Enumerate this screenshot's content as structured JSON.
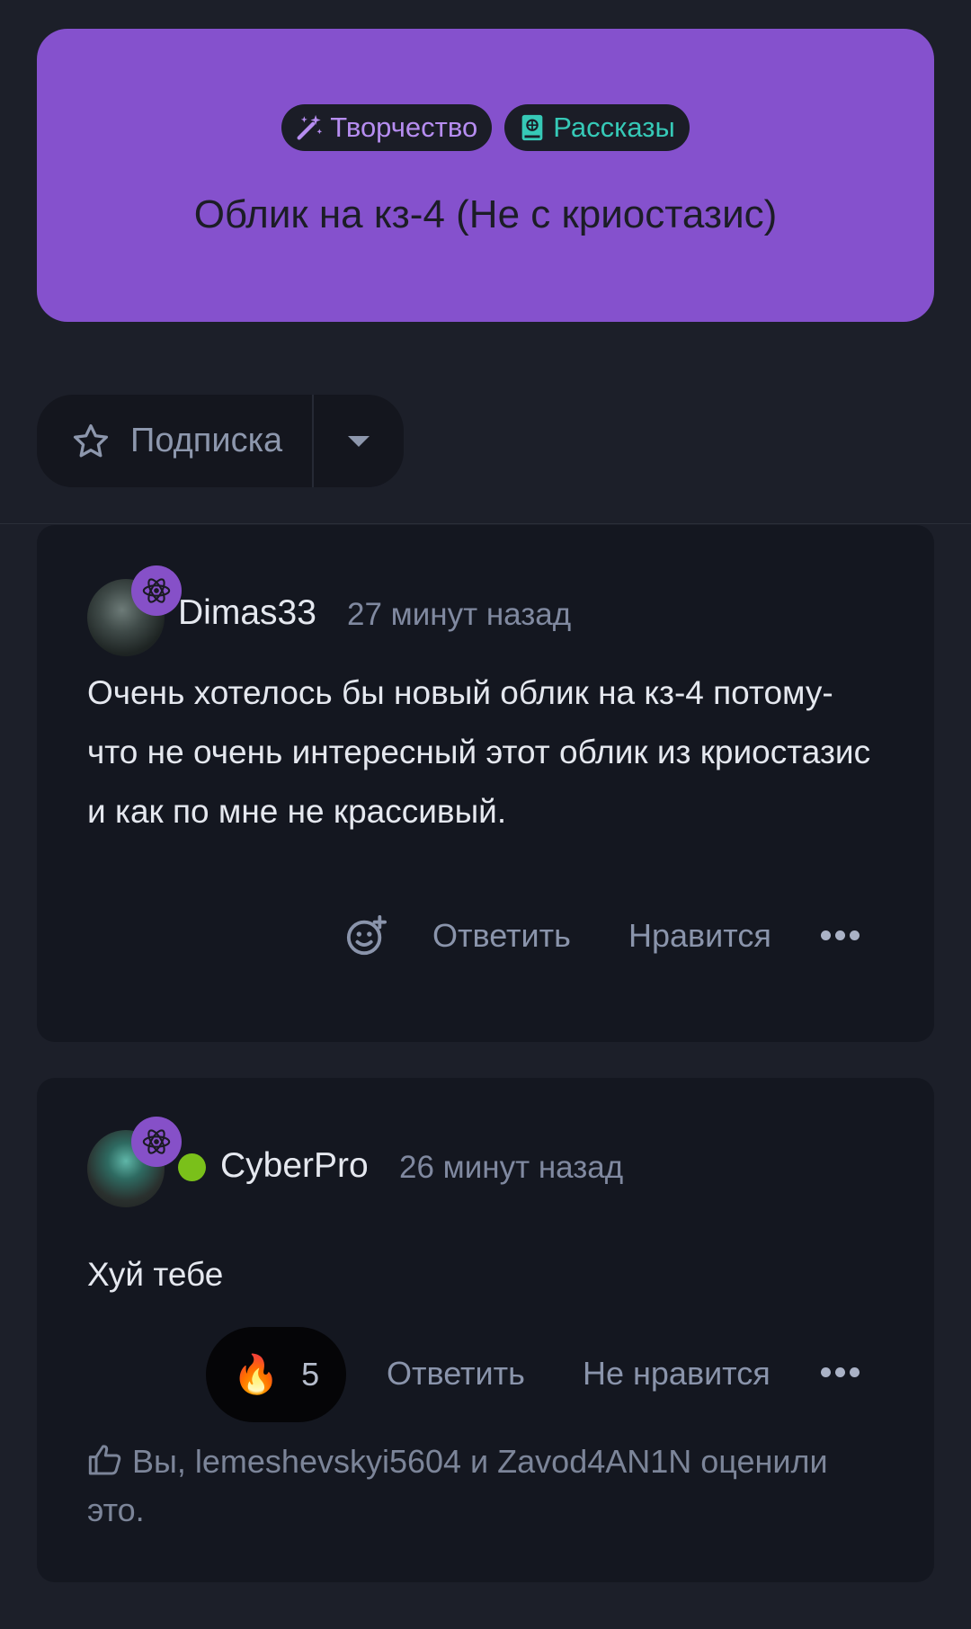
{
  "header": {
    "tags": [
      {
        "label": "Творчество",
        "icon": "magic-wand-icon",
        "color": "#b68df0"
      },
      {
        "label": "Рассказы",
        "icon": "book-icon",
        "color": "#36c9b7"
      }
    ],
    "title": "Облик на кз-4 (Не с криостазис)",
    "background": "#8551cd"
  },
  "follow": {
    "label": "Подписка",
    "icon": "star-icon",
    "menu_icon": "caret-down-icon"
  },
  "comments": [
    {
      "username": "Dimas33",
      "time": "27 минут назад",
      "online": false,
      "badge_icon": "atom-icon",
      "text": "Очень хотелось бы новый облик на кз-4 потому-что не очень интересный этот облик из криостазис и как по мне не крассивый.",
      "actions": {
        "reply": "Ответить",
        "like": "Нравится"
      }
    },
    {
      "username": "CyberPro",
      "time": "26 минут назад",
      "online": true,
      "badge_icon": "atom-icon",
      "text": "Хуй тебе",
      "reaction": {
        "emoji": "🔥",
        "count": "5"
      },
      "actions": {
        "reply": "Ответить",
        "like": "Не нравится"
      },
      "likes_text": "Вы, lemeshevskyi5604 и Zavod4AN1N оценили это."
    }
  ]
}
